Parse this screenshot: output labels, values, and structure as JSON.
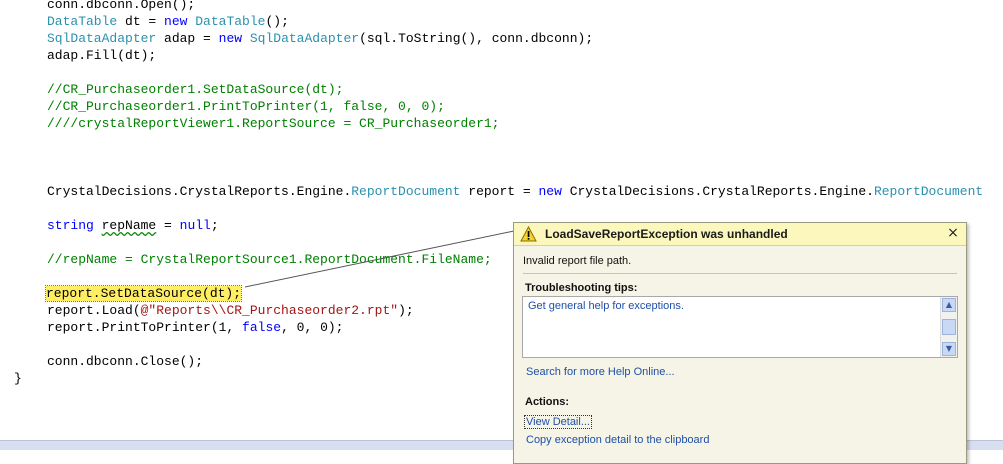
{
  "code": {
    "line1": {
      "a": "conn.dbconn.Open();"
    },
    "line2": {
      "t1": "DataTable",
      "a": " dt = ",
      "k1": "new",
      "t2": "DataTable",
      "b": "();"
    },
    "line3": {
      "t1": "SqlDataAdapter",
      "a": " adap = ",
      "k1": "new",
      "t2": "SqlDataAdapter",
      "b": "(sql.ToString(), conn.dbconn);"
    },
    "line4": {
      "a": "adap.Fill(dt);"
    },
    "line5": {
      "c": "//CR_Purchaseorder1.SetDataSource(dt);"
    },
    "line6": {
      "c": "//CR_Purchaseorder1.PrintToPrinter(1, false, 0, 0);"
    },
    "line7": {
      "c": "////crystalReportViewer1.ReportSource = CR_Purchaseorder1;"
    },
    "line8": {
      "a": "CrystalDecisions.CrystalReports.Engine.",
      "t1": "ReportDocument",
      "b": " report = ",
      "k1": "new",
      "c": " CrystalDecisions.CrystalReports.Engine.",
      "t2": "ReportDocument"
    },
    "line9": {
      "k1": "string",
      "sp": " ",
      "sq": "repName",
      "b": " = ",
      "k2": "null",
      "e": ";"
    },
    "line10": {
      "c": "//repName = CrystalReportSource1.ReportDocument.FileName;"
    },
    "line11": {
      "h": "report.SetDataSource(dt);"
    },
    "line12": {
      "a": "report.Load(",
      "s": "@\"Reports\\\\CR_Purchaseorder2.rpt\"",
      "b": ");"
    },
    "line13": {
      "a": "report.PrintToPrinter(1, ",
      "k1": "false",
      "b": ", 0, 0);"
    },
    "line14": {
      "a": "conn.dbconn.Close();"
    },
    "line15": {
      "a": "}"
    }
  },
  "exception_helper": {
    "title": "LoadSaveReportException was unhandled",
    "close": "×",
    "message": "Invalid report file path.",
    "tips_label": "Troubleshooting tips:",
    "tips": [
      "Get general help for exceptions."
    ],
    "search_link": "Search for more Help Online...",
    "actions_label": "Actions:",
    "actions": [
      "View Detail...",
      "Copy exception detail to the clipboard"
    ],
    "scroll_up": "▲",
    "scroll_down": "▼"
  },
  "colors": {
    "keyword": "#0000ff",
    "type": "#2b91af",
    "comment": "#008000",
    "string": "#a31515",
    "highlight": "#ffee62",
    "popup_header": "#fbf7bd",
    "link": "#1f4fa8"
  },
  "icons": {
    "warning": "warning-icon",
    "close": "close-icon"
  }
}
